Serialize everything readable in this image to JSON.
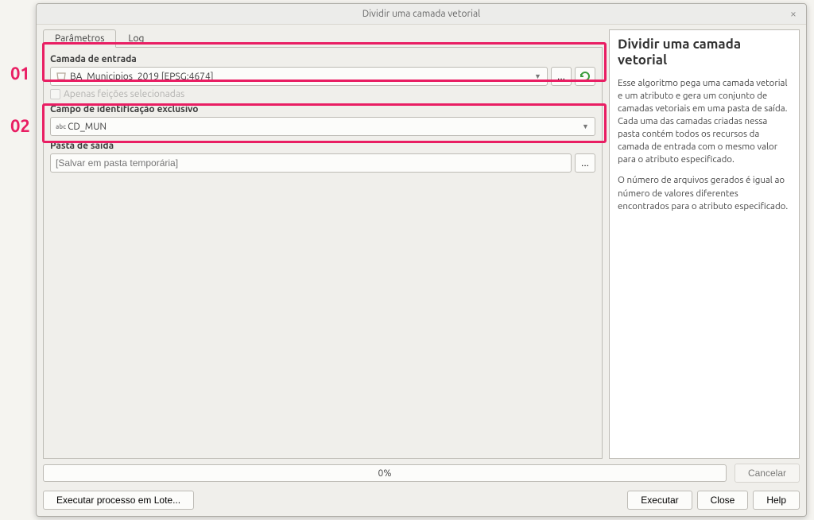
{
  "annotations": {
    "one": "01",
    "two": "02"
  },
  "dialog": {
    "title": "Dividir uma camada vetorial"
  },
  "tabs": {
    "params": "Parâmetros",
    "log": "Log"
  },
  "fields": {
    "input_layer_label": "Camada de entrada",
    "input_layer_value": "BA_Municipios_2019 [EPSG:4674]",
    "selected_only_label": "Apenas feições selecionadas",
    "id_field_label": "Campo de identificação exclusivo",
    "id_field_prefix": "abc",
    "id_field_value": "CD_MUN",
    "output_folder_label": "Pasta de saída",
    "output_folder_placeholder": "[Salvar em pasta temporária]",
    "browse_dots": "..."
  },
  "help": {
    "title": "Dividir uma camada vetorial",
    "p1": "Esse algoritmo pega uma camada vetorial e um atributo e gera um conjunto de camadas vetoriais em uma pasta de saída. Cada uma das camadas criadas nessa pasta contém todos os recursos da camada de entrada com o mesmo valor para o atributo especificado.",
    "p2": "O número de arquivos gerados é igual ao número de valores diferentes encontrados para o atributo especificado."
  },
  "progress": {
    "text": "0%"
  },
  "buttons": {
    "cancel": "Cancelar",
    "batch": "Executar processo em Lote...",
    "run": "Executar",
    "close": "Close",
    "help": "Help"
  }
}
